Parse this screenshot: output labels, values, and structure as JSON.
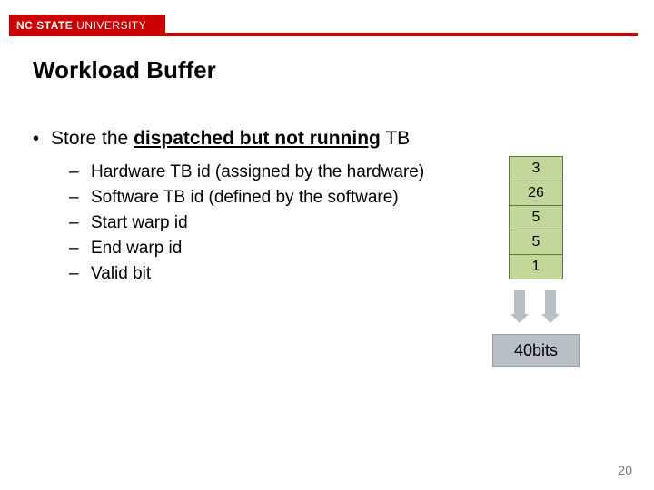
{
  "brand": {
    "bold": "NC STATE",
    "light": "UNIVERSITY"
  },
  "title": "Workload Buffer",
  "main_bullet": {
    "prefix": "Store the ",
    "emph": "dispatched but not running",
    "suffix": " TB"
  },
  "sub_bullets": [
    "Hardware TB id (assigned by the hardware)",
    "Software TB id   (defined by the software)",
    "Start warp id",
    "End warp id",
    "Valid bit"
  ],
  "field_bits": [
    "3",
    "26",
    "5",
    "5",
    "1"
  ],
  "total_bits_label": "40bits",
  "page_number": "20"
}
